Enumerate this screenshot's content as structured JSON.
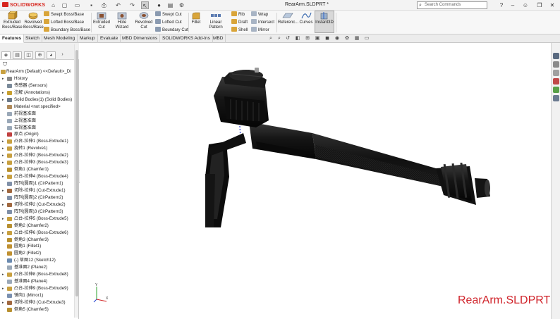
{
  "app": {
    "brand": "SOLIDWORKS",
    "document_title": "RearArm.SLDPRT *",
    "search_placeholder": "Search Commands"
  },
  "ribbon": {
    "extruded_boss": "Extruded Boss/Base",
    "revolved_boss": "Revolved Boss/Base",
    "swept_boss": "Swept Boss/Base",
    "lofted_boss": "Lofted Boss/Base",
    "boundary_boss": "Boundary Boss/Base",
    "extruded_cut": "Extruded Cut",
    "hole_wizard": "Hole Wizard",
    "revolved_cut": "Revolved Cut",
    "swept_cut": "Swept Cut",
    "lofted_cut": "Lofted Cut",
    "boundary_cut": "Boundary Cut",
    "fillet": "Fillet",
    "linear_pattern": "Linear Pattern",
    "rib": "Rib",
    "draft": "Draft",
    "shell": "Shell",
    "wrap": "Wrap",
    "intersect": "Intersect",
    "mirror": "Mirror",
    "reference": "Referenc...",
    "curves": "Curves",
    "instant3d": "Instant3D"
  },
  "tabs": [
    "Features",
    "Sketch",
    "Mesh Modeling",
    "Markup",
    "Evaluate",
    "MBD Dimensions",
    "SOLIDWORKS Add-Ins",
    "MBD"
  ],
  "active_tab": "Features",
  "tree": {
    "root": "RearArm (Default) <<Default>_Di",
    "items": [
      {
        "label": "History",
        "arrow": true,
        "icon": "history-icon",
        "color": "#8a8a8a"
      },
      {
        "label": "传感器 (Sensors)",
        "arrow": false,
        "icon": "sensor-icon",
        "color": "#7a8a9a"
      },
      {
        "label": "注解 (Annotations)",
        "arrow": true,
        "icon": "annotation-icon",
        "color": "#c8a030"
      },
      {
        "label": "Solid Bodies(1) (Solid Bodies)",
        "arrow": true,
        "icon": "solid-bodies-icon",
        "color": "#6c7a8a"
      },
      {
        "label": "Material <not specified>",
        "arrow": false,
        "icon": "material-icon",
        "color": "#b08a5a"
      },
      {
        "label": "前视基准面",
        "arrow": false,
        "icon": "plane-icon",
        "color": "#9aa8b8"
      },
      {
        "label": "上视基准面",
        "arrow": false,
        "icon": "plane-icon",
        "color": "#9aa8b8"
      },
      {
        "label": "右视基准面",
        "arrow": false,
        "icon": "plane-icon",
        "color": "#9aa8b8"
      },
      {
        "label": "原点 (Origin)",
        "arrow": false,
        "icon": "origin-icon",
        "color": "#c04040"
      },
      {
        "label": "凸台-拉伸1 (Boss-Extrude1)",
        "arrow": true,
        "icon": "boss-extrude-icon",
        "color": "#c8a040"
      },
      {
        "label": "旋转1 (Revolve1)",
        "arrow": true,
        "icon": "revolve-icon",
        "color": "#c8a040"
      },
      {
        "label": "凸台-拉伸2 (Boss-Extrude2)",
        "arrow": true,
        "icon": "boss-extrude-icon",
        "color": "#c8a040"
      },
      {
        "label": "凸台-拉伸3 (Boss-Extrude3)",
        "arrow": true,
        "icon": "boss-extrude-icon",
        "color": "#c8a040"
      },
      {
        "label": "倒角1 (Chamfer1)",
        "arrow": false,
        "icon": "chamfer-icon",
        "color": "#b89030"
      },
      {
        "label": "凸台-拉伸4 (Boss-Extrude4)",
        "arrow": true,
        "icon": "boss-extrude-icon",
        "color": "#c8a040"
      },
      {
        "label": "阵列(圆周)1 (CirPattern1)",
        "arrow": false,
        "icon": "circular-pattern-icon",
        "color": "#8090a8"
      },
      {
        "label": "切除-拉伸1 (Cut-Extrude1)",
        "arrow": true,
        "icon": "cut-extrude-icon",
        "color": "#a06840"
      },
      {
        "label": "阵列(圆周)2 (CirPattern2)",
        "arrow": false,
        "icon": "circular-pattern-icon",
        "color": "#8090a8"
      },
      {
        "label": "切除-拉伸2 (Cut-Extrude2)",
        "arrow": true,
        "icon": "cut-extrude-icon",
        "color": "#a06840"
      },
      {
        "label": "阵列(圆周)3 (CirPattern3)",
        "arrow": false,
        "icon": "circular-pattern-icon",
        "color": "#8090a8"
      },
      {
        "label": "凸台-拉伸5 (Boss-Extrude5)",
        "arrow": true,
        "icon": "boss-extrude-icon",
        "color": "#c8a040"
      },
      {
        "label": "倒角2 (Chamfer2)",
        "arrow": false,
        "icon": "chamfer-icon",
        "color": "#b89030"
      },
      {
        "label": "凸台-拉伸6 (Boss-Extrude6)",
        "arrow": true,
        "icon": "boss-extrude-icon",
        "color": "#c8a040"
      },
      {
        "label": "倒角3 (Chamfer3)",
        "arrow": false,
        "icon": "chamfer-icon",
        "color": "#b89030"
      },
      {
        "label": "圆角1 (Fillet1)",
        "arrow": false,
        "icon": "fillet-icon",
        "color": "#c09030"
      },
      {
        "label": "圆角2 (Fillet2)",
        "arrow": false,
        "icon": "fillet-icon",
        "color": "#c09030"
      },
      {
        "label": "(-) 草图12 (Sketch12)",
        "arrow": false,
        "icon": "sketch-icon",
        "color": "#6a8ab0"
      },
      {
        "label": "基准面2 (Plane2)",
        "arrow": false,
        "icon": "plane-icon",
        "color": "#9aa8b8"
      },
      {
        "label": "凸台-拉伸8 (Boss-Extrude8)",
        "arrow": true,
        "icon": "boss-extrude-icon",
        "color": "#c8a040"
      },
      {
        "label": "基准面4 (Plane4)",
        "arrow": false,
        "icon": "plane-icon",
        "color": "#9aa8b8"
      },
      {
        "label": "凸台-拉伸9 (Boss-Extrude9)",
        "arrow": true,
        "icon": "boss-extrude-icon",
        "color": "#c8a040"
      },
      {
        "label": "镜向1 (Mirror1)",
        "arrow": false,
        "icon": "mirror-icon",
        "color": "#7a90b0"
      },
      {
        "label": "切除-拉伸3 (Cut-Extrude3)",
        "arrow": true,
        "icon": "cut-extrude-icon",
        "color": "#a06840"
      },
      {
        "label": "倒角5 (Chamfer5)",
        "arrow": false,
        "icon": "chamfer-icon",
        "color": "#b89030"
      }
    ]
  },
  "viewport": {
    "watermark": "RearArm.SLDPRT",
    "watermark_color": "#d0232a",
    "model_color": "#161616"
  },
  "colors": {
    "accent_red": "#d7261e",
    "instant3d_bg": "#d8d8d8"
  }
}
